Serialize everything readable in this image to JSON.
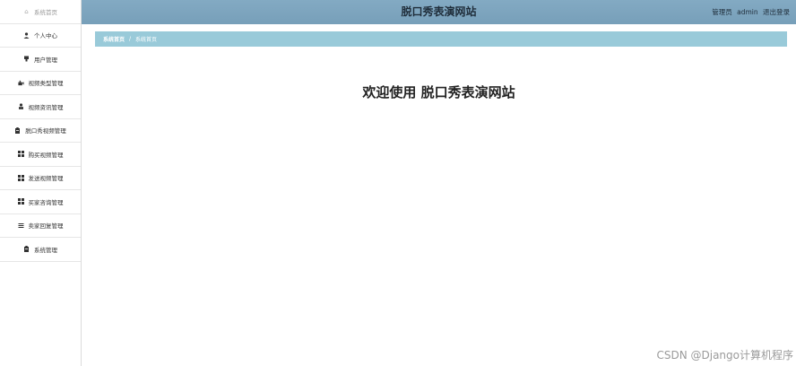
{
  "header": {
    "site_title": "脱口秀表演网站",
    "role": "管理员",
    "username": "admin",
    "logout_label": "退出登录"
  },
  "sidebar": {
    "items": [
      {
        "label": "系统首页",
        "icon": "home-icon"
      },
      {
        "label": "个人中心",
        "icon": "user-icon"
      },
      {
        "label": "用户管理",
        "icon": "user-manage-icon"
      },
      {
        "label": "视频类型管理",
        "icon": "video-type-icon"
      },
      {
        "label": "视频资讯管理",
        "icon": "person-icon"
      },
      {
        "label": "脱口秀视频管理",
        "icon": "clipboard-icon"
      },
      {
        "label": "购买视频管理",
        "icon": "grid-icon"
      },
      {
        "label": "发送视频管理",
        "icon": "grid-icon"
      },
      {
        "label": "买家咨询管理",
        "icon": "grid-icon"
      },
      {
        "label": "卖家回复管理",
        "icon": "list-icon"
      },
      {
        "label": "系统管理",
        "icon": "clipboard-icon"
      }
    ]
  },
  "breadcrumb": {
    "first": "系统首页",
    "separator": "/",
    "current": "系统首页"
  },
  "main": {
    "welcome_text": "欢迎使用 脱口秀表演网站"
  },
  "watermark": "CSDN @Django计算机程序",
  "colors": {
    "topbar": "#7fa6c0",
    "breadcrumb_bar": "#99cad9"
  }
}
